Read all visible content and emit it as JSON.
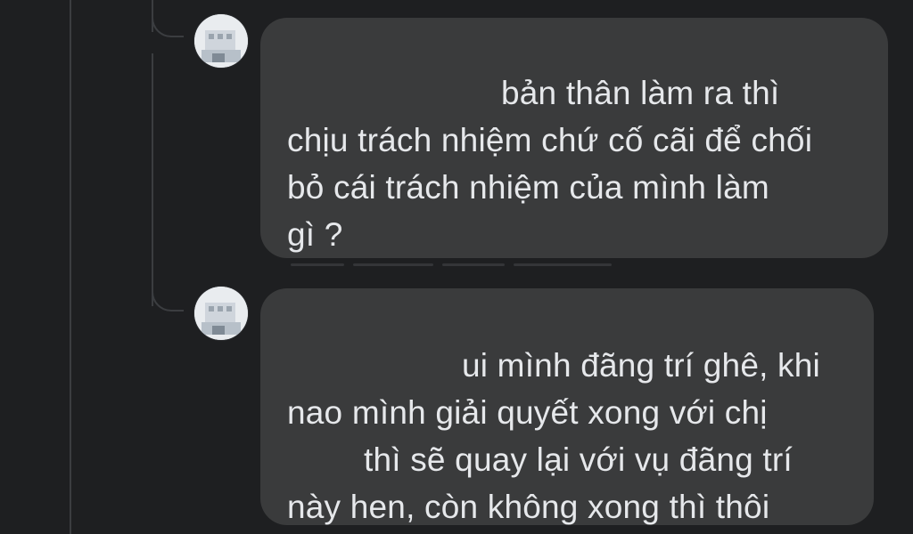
{
  "thread": {
    "comments": [
      {
        "avatar_icon": "user-avatar-icon",
        "lines": [
          "bản thân làm ra thì",
          "chịu trách nhiệm chứ cố cãi để chối",
          "bỏ cái trách nhiệm của mình làm",
          "gì ?"
        ]
      },
      {
        "avatar_icon": "user-avatar-icon",
        "lines": [
          "ui mình đãng trí ghê, khi",
          "nao mình giải quyết xong với chị",
          "thì sẽ quay lại với vụ đãng trí",
          "này hen, còn không xong thì thôi"
        ]
      }
    ]
  },
  "colors": {
    "background": "#1e1f21",
    "bubble": "#3a3b3c",
    "text": "#e6e8eb",
    "thread_line": "#3b3d40"
  }
}
